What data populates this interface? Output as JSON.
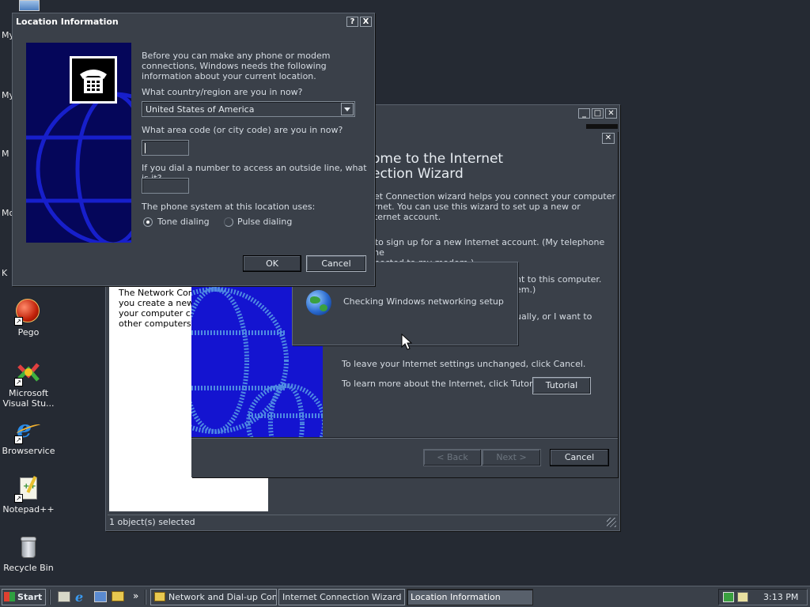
{
  "desktop": {
    "edge_labels": [
      "My",
      "My",
      "M",
      "Mo",
      "K"
    ],
    "icons": [
      {
        "label": "Pego",
        "icon": "pego-icon"
      },
      {
        "label": "Microsoft Visual Stu...",
        "icon": "visual-studio-icon"
      },
      {
        "label": "Browservice",
        "icon": "internet-explorer-icon"
      },
      {
        "label": "Notepad++",
        "icon": "notepad-plus-plus-icon"
      },
      {
        "label": "Recycle Bin",
        "icon": "recycle-bin-icon"
      }
    ]
  },
  "network_window": {
    "description_lines": [
      "The Network Conne",
      "you create a new c",
      "your computer can",
      "other computers an"
    ],
    "status_bar": "1 object(s) selected"
  },
  "wizard": {
    "heading_line1": "ome to the Internet",
    "heading_line2": "ection Wizard",
    "intro_lines": [
      "net Connection wizard helps you connect your computer",
      "ernet.  You can use this wizard to set up a new or",
      "nternet account."
    ],
    "option1_lines": [
      "t to sign up for a new Internet account. (My telephone line",
      "nnected to my modem.)"
    ],
    "option2_lines": [
      "nt to this computer.",
      "em.)"
    ],
    "option3_lines": [
      "ually, or I want to",
      ""
    ],
    "leave_text": "To leave your Internet settings unchanged, click Cancel.",
    "learn_text": "To learn more about the Internet, click Tutorial.",
    "tutorial_label": "Tutorial",
    "back_label": "< Back",
    "next_label": "Next >",
    "cancel_label": "Cancel"
  },
  "progress_popup": {
    "text": "Checking Windows networking setup"
  },
  "location_dialog": {
    "title": "Location Information",
    "help_label": "?",
    "close_label": "X",
    "intro": "Before you can make any phone or modem connections, Windows needs the following information about your current location.",
    "country_question": "What country/region are you in now?",
    "country_value": "United States of America",
    "area_code_question": "What area code (or city code) are you in now?",
    "area_code_value": "",
    "outside_line_question": "If you dial a number to access an outside line, what is it?",
    "outside_line_value": "",
    "phone_system_label": "The phone system at this location uses:",
    "tone_label": "Tone dialing",
    "pulse_label": "Pulse dialing",
    "tone_selected": true,
    "ok_label": "OK",
    "cancel_label": "Cancel"
  },
  "taskbar": {
    "start_label": "Start",
    "quicklaunch_more": "»",
    "tasks": [
      {
        "label": "Network and Dial-up Con...",
        "active": false
      },
      {
        "label": "Internet Connection Wizard",
        "active": false
      },
      {
        "label": "Location Information",
        "active": true
      }
    ],
    "clock": "3:13 PM"
  },
  "colors": {
    "desktop": "#252a33",
    "window": "#3a4049",
    "accent_blue": "#1a1ac8"
  }
}
